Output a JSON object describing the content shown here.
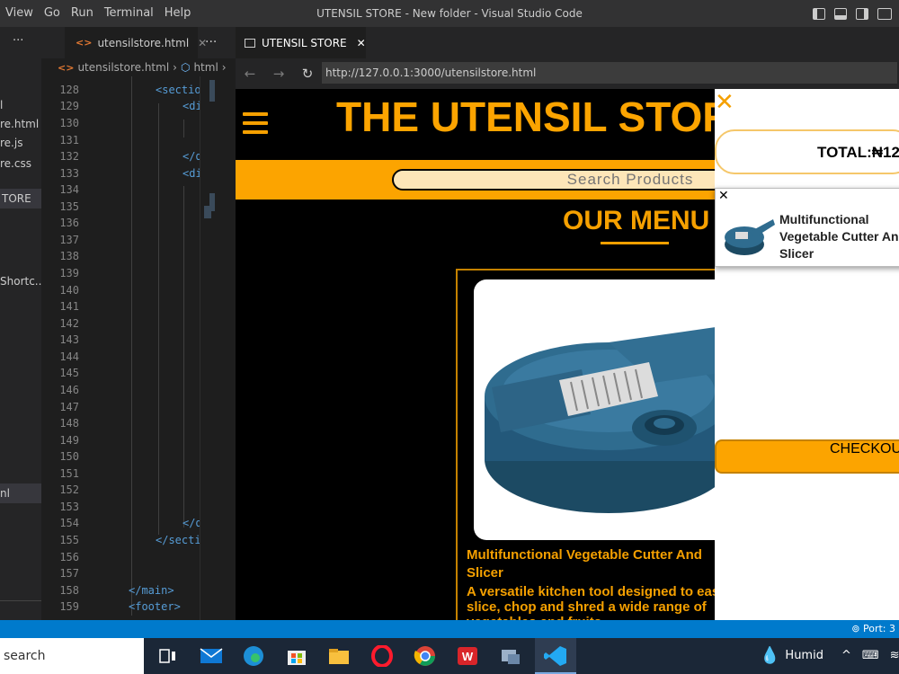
{
  "titlebar": {
    "menu": [
      "View",
      "Go",
      "Run",
      "Terminal",
      "Help"
    ],
    "window_title": "UTENSIL STORE - New folder - Visual Studio Code"
  },
  "sidebar": {
    "items": [
      {
        "label": "l"
      },
      {
        "label": "re.html"
      },
      {
        "label": "re.js"
      },
      {
        "label": "re.css"
      },
      {
        "label": "TORE"
      },
      {
        "label": "Shortc..."
      },
      {
        "label": "nl"
      }
    ],
    "more_label": "···"
  },
  "editor": {
    "tab_label": "utensilstore.html",
    "tab_more": "···",
    "breadcrumb": [
      "utensilstore.html",
      "html"
    ],
    "line_numbers": [
      "128",
      "129",
      "130",
      "131",
      "132",
      "133",
      "134",
      "135",
      "136",
      "137",
      "138",
      "139",
      "140",
      "141",
      "142",
      "143",
      "144",
      "145",
      "146",
      "147",
      "148",
      "149",
      "150",
      "151",
      "152",
      "153",
      "154",
      "155",
      "156",
      "157",
      "158",
      "159"
    ],
    "code": {
      "l128": "<sectio",
      "l129": "<di",
      "l132": "</d",
      "l133": "<di",
      "l154": "</d",
      "l155": "</secti",
      "l158": "</main>",
      "l159": "<footer>"
    }
  },
  "browser": {
    "tab_title": "UTENSIL STORE",
    "url": "http://127.0.0.1:3000/utensilstore.html"
  },
  "webpage": {
    "store_title": "THE UTENSIL STORE",
    "search_placeholder": "Search Products",
    "menu_heading": "OUR MENU",
    "product": {
      "name": "Multifunctional Vegetable Cutter And Slicer",
      "description": "A versatile kitchen tool designed to easily slice, chop and shred a wide range of vegetables and fruits."
    }
  },
  "cart": {
    "close_glyph": "✕",
    "total_label": "TOTAL:₦12",
    "item_close": "✕",
    "item_name": "Multifunctional Vegetable Cutter And Slicer",
    "checkout_label": "CHECKOUT"
  },
  "statusbar": {
    "port": "Port: 3"
  },
  "taskbar": {
    "search_label": "search",
    "weather": "Humid"
  },
  "colors": {
    "accent": "#fca400",
    "vscode_blue": "#007acc"
  }
}
